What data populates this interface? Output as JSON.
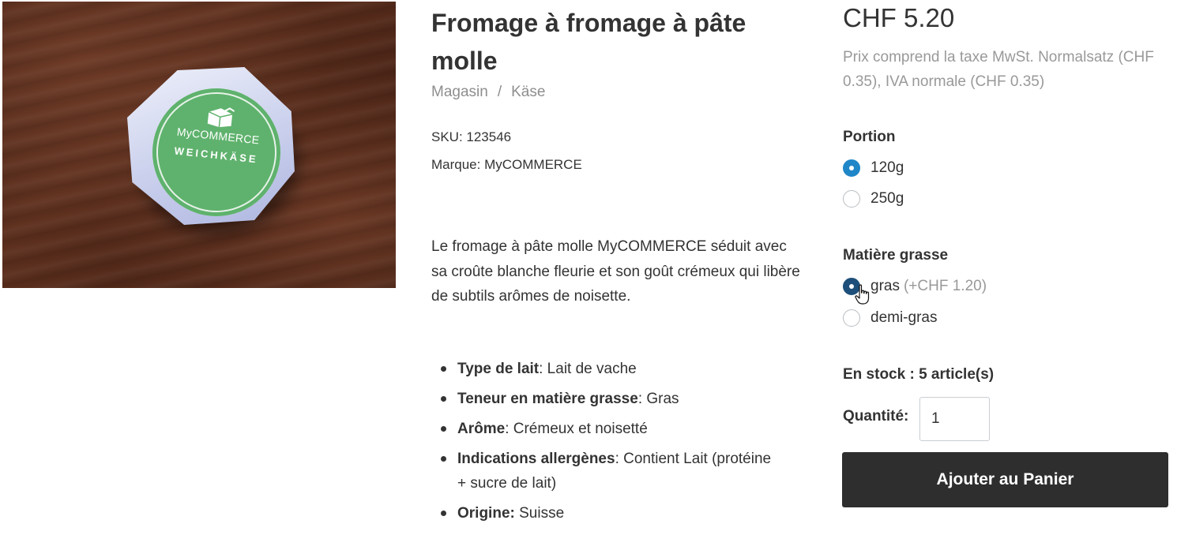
{
  "product": {
    "image": {
      "alt_brand": "MyCOMMERCE",
      "alt_type": "WEICHKÄSE",
      "colors": {
        "label_green": "#5fb26d",
        "wood": "#5e301e",
        "wrap": "#c9cfec"
      }
    },
    "title": "Fromage à fromage à pâte molle",
    "breadcrumb": {
      "items": [
        "Magasin",
        "Käse"
      ],
      "separator": "/"
    },
    "sku": "SKU: 123546",
    "brand": "Marque: MyCOMMERCE",
    "description": "Le fromage à pâte molle MyCOMMERCE séduit avec sa croûte blanche fleurie et son goût crémeux qui libère de subtils arômes de noisette.",
    "features": [
      {
        "label": "Type de lait",
        "value": ": Lait de vache"
      },
      {
        "label": "Teneur en matière grasse",
        "value": ": Gras"
      },
      {
        "label": "Arôme",
        "value": ": Crémeux et noisetté"
      },
      {
        "label": "Indications allergènes",
        "value": ": Contient Lait (protéine + sucre de lait)"
      },
      {
        "label": "Origine:",
        "value": " Suisse"
      }
    ]
  },
  "purchase": {
    "price": "CHF 5.20",
    "tax_note": "Prix comprend la taxe MwSt. Normalsatz (CHF 0.35), IVA normale (CHF 0.35)",
    "portion": {
      "heading": "Portion",
      "options": [
        {
          "label": "120g",
          "checked": true
        },
        {
          "label": "250g",
          "checked": false
        }
      ]
    },
    "fat": {
      "heading": "Matière grasse",
      "options": [
        {
          "label": "gras",
          "surcharge": "(+CHF 1.20)",
          "checked": true
        },
        {
          "label": "demi-gras",
          "checked": false
        }
      ]
    },
    "stock": "En stock : 5 article(s)",
    "quantity_label": "Quantité:",
    "quantity_value": "1",
    "add_to_cart": "Ajouter au Panier",
    "colors": {
      "accent": "#1f86c8",
      "button": "#2e2e2e",
      "muted": "#999999"
    }
  }
}
